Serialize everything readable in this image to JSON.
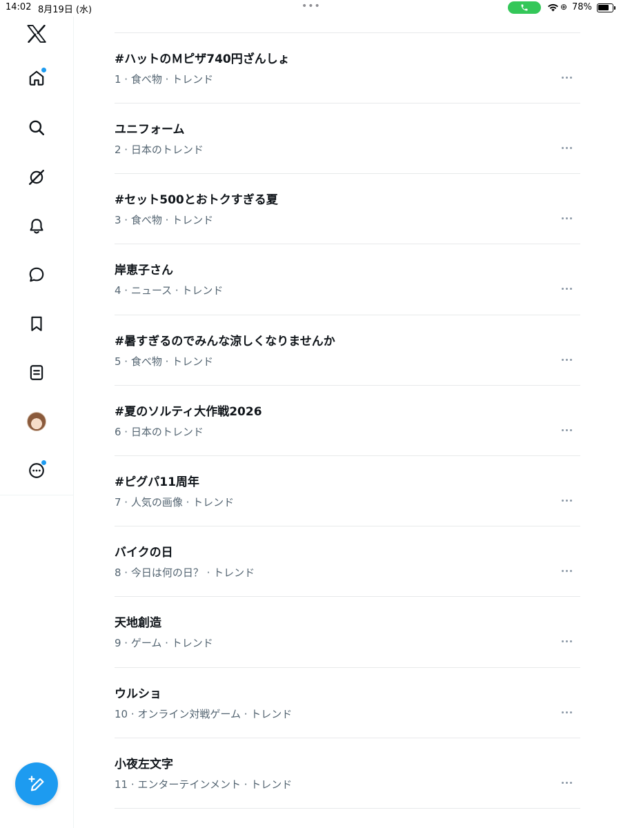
{
  "status_bar": {
    "time": "14:02",
    "date": "8月19日 (水)",
    "multitask": "•••",
    "location_symbol": "⊕",
    "battery_percent_label": "78%",
    "battery_level": 0.78,
    "call_color": "#34c759"
  },
  "sidebar": {
    "items": [
      {
        "name": "home",
        "icon": "home-icon",
        "badge": true
      },
      {
        "name": "explore",
        "icon": "search-icon",
        "badge": false
      },
      {
        "name": "grok",
        "icon": "grok-icon",
        "badge": false
      },
      {
        "name": "notifications",
        "icon": "bell-icon",
        "badge": false
      },
      {
        "name": "messages",
        "icon": "chat-bubble-icon",
        "badge": false
      },
      {
        "name": "bookmarks",
        "icon": "bookmark-icon",
        "badge": false
      },
      {
        "name": "lists",
        "icon": "list-icon",
        "badge": false
      },
      {
        "name": "profile",
        "icon": "avatar",
        "badge": false
      },
      {
        "name": "more",
        "icon": "more-circle-icon",
        "badge": true
      }
    ],
    "compose_icon": "compose-icon",
    "accent_color": "#1d9bf0"
  },
  "trends": [
    {
      "title": "#ハットのＭピザ740円ざんしょ",
      "meta": "1 · 食べ物 · トレンド"
    },
    {
      "title": "ユニフォーム",
      "meta": "2 · 日本のトレンド"
    },
    {
      "title": "#セット500とおトクすぎる夏",
      "meta": "3 · 食べ物 · トレンド"
    },
    {
      "title": "岸恵子さん",
      "meta": "4 · ニュース · トレンド"
    },
    {
      "title": "#暑すぎるのでみんな涼しくなりませんか",
      "meta": "5 · 食べ物 · トレンド"
    },
    {
      "title": "#夏のソルティ大作戦2026",
      "meta": "6 · 日本のトレンド"
    },
    {
      "title": "#ピグパ11周年",
      "meta": "7 · 人気の画像 · トレンド"
    },
    {
      "title": "バイクの日",
      "meta": "8 · 今日は何の日？ · トレンド"
    },
    {
      "title": "天地創造",
      "meta": "9 · ゲーム · トレンド"
    },
    {
      "title": "ウルショ",
      "meta": "10 · オンライン対戦ゲーム · トレンド"
    },
    {
      "title": "小夜左文字",
      "meta": "11 · エンターテインメント · トレンド"
    }
  ],
  "colors": {
    "text_primary": "#0f1419",
    "text_secondary": "#536471",
    "divider": "#e7e9ea"
  }
}
